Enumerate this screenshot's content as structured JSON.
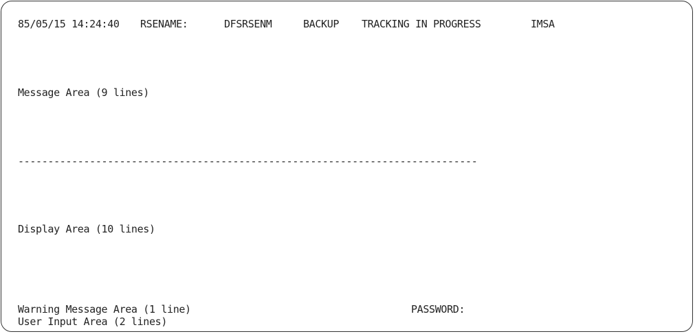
{
  "status_line": {
    "timestamp": "85/05/15 14:24:40",
    "rsename_label": "RSENAME:",
    "rsename_value": "DFSRSENM",
    "mode": "BACKUP",
    "state": "TRACKING IN PROGRESS",
    "system": "IMSA"
  },
  "areas": {
    "message": "Message Area (9 lines)",
    "separator": "-----------------------------------------------------------------------------",
    "display": "Display Area (10 lines)",
    "warning": "Warning Message Area (1 line)",
    "password_label": "PASSWORD:",
    "input": "User Input Area (2 lines)"
  }
}
